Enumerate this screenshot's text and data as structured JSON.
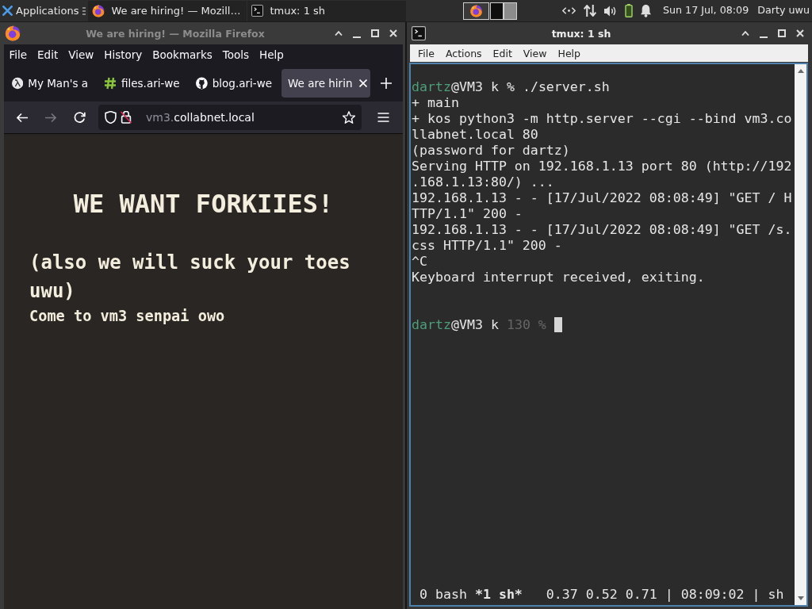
{
  "panel": {
    "apps_label": "Applications",
    "tasks": [
      {
        "kind": "browser",
        "label": "We are hiring! — Mozill…"
      },
      {
        "kind": "terminal",
        "label": "tmux: 1 sh"
      }
    ],
    "clock": "Sun 17 Jul, 08:09",
    "user": "Darty uwu"
  },
  "browser": {
    "title": "We are hiring! — Mozilla Firefox",
    "focused": false,
    "menu": [
      "File",
      "Edit",
      "View",
      "History",
      "Bookmarks",
      "Tools",
      "Help"
    ],
    "tabs": [
      {
        "kind": "lambda",
        "label": "My Man's a",
        "selected": false
      },
      {
        "kind": "hash",
        "label": "files.ari-we",
        "selected": false
      },
      {
        "kind": "cat",
        "label": "blog.ari-we",
        "selected": false
      },
      {
        "kind": "plain",
        "label": "We are hirin",
        "selected": true
      }
    ],
    "nav_buttons": [
      {
        "kind": "back",
        "disabled": false
      },
      {
        "kind": "forward",
        "disabled": true
      },
      {
        "kind": "reload",
        "disabled": false
      }
    ],
    "url": {
      "subdomain": "vm3.",
      "domain": "collabnet.local",
      "secure": false
    },
    "page": {
      "heading": "WE WANT FORKIIES!",
      "subheading": "(also we will suck your toes uwu)",
      "text": "Come to vm3 senpai owo"
    }
  },
  "terminal": {
    "title": "tmux: 1 sh",
    "focused": true,
    "menu": [
      "File",
      "Actions",
      "Edit",
      "View",
      "Help"
    ],
    "lines": [
      {
        "kind": "prompt",
        "user": "dartz",
        "location": "@VM3 k",
        "symbol": "%",
        "command": "./server.sh",
        "cursor": false
      },
      {
        "kind": "output",
        "text": "+ main"
      },
      {
        "kind": "output",
        "text": "+ kos python3 -m http.server --cgi --bind vm3.collabnet.local 80"
      },
      {
        "kind": "output",
        "text": "(password for dartz)"
      },
      {
        "kind": "output",
        "text": "Serving HTTP on 192.168.1.13 port 80 (http://192.168.1.13:80/) ..."
      },
      {
        "kind": "output",
        "text": "192.168.1.13 - - [17/Jul/2022 08:08:49] \"GET / HTTP/1.1\" 200 -"
      },
      {
        "kind": "output",
        "text": "192.168.1.13 - - [17/Jul/2022 08:08:49] \"GET /s.css HTTP/1.1\" 200 -"
      },
      {
        "kind": "output",
        "text": "^C"
      },
      {
        "kind": "output",
        "text": "Keyboard interrupt received, exiting."
      },
      {
        "kind": "blank"
      },
      {
        "kind": "blank"
      },
      {
        "kind": "prompt",
        "user": "dartz",
        "location": "@VM3 k",
        "status": "130",
        "symbol": "%",
        "cursor": true
      }
    ],
    "status": {
      "windows": [
        {
          "label": "0 bash",
          "selected": false
        },
        {
          "label": "*1 sh*",
          "selected": true
        }
      ],
      "info": "0.37 0.52 0.71 | 08:09:02 | sh"
    }
  }
}
